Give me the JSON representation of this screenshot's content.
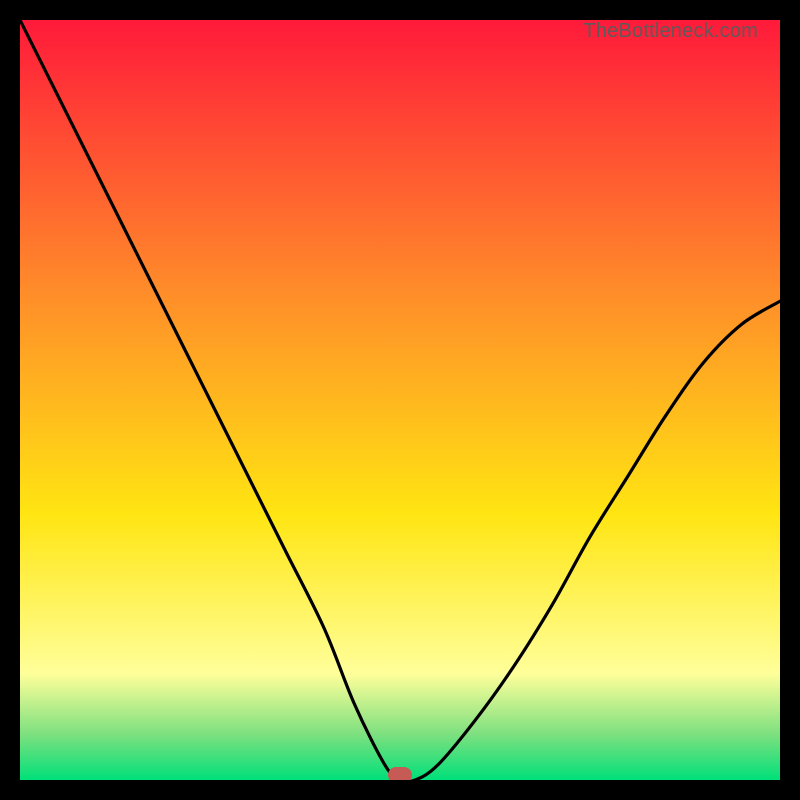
{
  "watermark": "TheBottleneck.com",
  "colors": {
    "black": "#000000",
    "red_top": "#ff1a3a",
    "orange_mid": "#ff8a2a",
    "yellow": "#ffe512",
    "pale_yellow": "#ffff9a",
    "green_band": "#7de07f",
    "green_bottom": "#00e07a",
    "curve": "#000000",
    "marker": "#c65a55"
  },
  "chart_data": {
    "type": "line",
    "title": "",
    "xlabel": "",
    "ylabel": "",
    "xlim": [
      0,
      100
    ],
    "ylim": [
      0,
      100
    ],
    "annotations": [
      "TheBottleneck.com"
    ],
    "marker": {
      "x": 50,
      "y": 0
    },
    "series": [
      {
        "name": "bottleneck-curve",
        "x": [
          0,
          5,
          10,
          15,
          20,
          25,
          30,
          35,
          40,
          44,
          48,
          50,
          52,
          55,
          60,
          65,
          70,
          75,
          80,
          85,
          90,
          95,
          100
        ],
        "values": [
          100,
          90,
          80,
          70,
          60,
          50,
          40,
          30,
          20,
          10,
          2,
          0,
          0,
          2,
          8,
          15,
          23,
          32,
          40,
          48,
          55,
          60,
          63
        ]
      }
    ]
  }
}
